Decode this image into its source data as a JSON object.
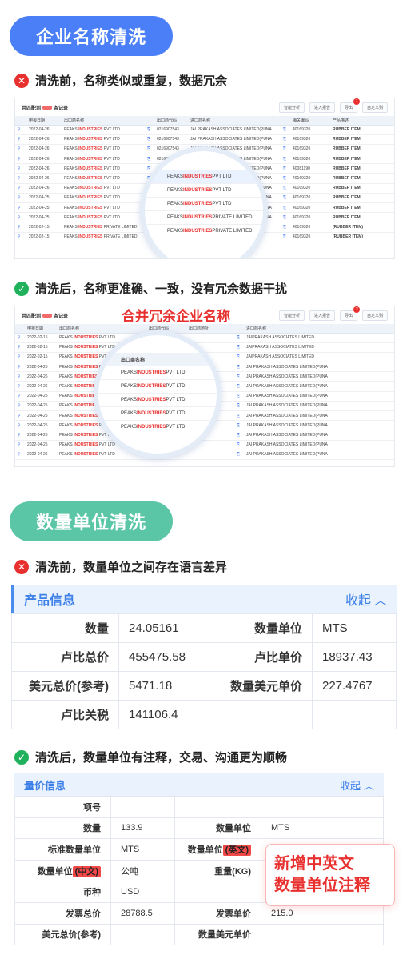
{
  "section1": {
    "title": "企业名称清洗",
    "before_caption": "清洗前，名称类似或重复，数据冗余",
    "after_caption": "清洗后，名称更准确、一致，没有冗余数据干扰",
    "before_shot": {
      "header_title": "共匹配到",
      "header_suffix": "条记录",
      "tools": [
        "智能分析",
        "进入报告",
        "导出",
        "自定义列"
      ],
      "badge": "1",
      "columns": [
        "申报日期",
        "出口商名称",
        "出口商代码",
        "进口商名称",
        "海关编码",
        "产品描述"
      ],
      "rows": [
        [
          "2022-04-26",
          "PEAKS ",
          "INDUSTRIES",
          " PVT LTD",
          "0216907543",
          "JAI PRAKASH ASSOCIATES LIMITED(PUNA",
          "40169320",
          "RUBBER ITEM"
        ],
        [
          "2022-04-26",
          "PEAKS ",
          "INDUSTRIES",
          " PVT LTD",
          "0216907543",
          "JAI PRAKASH ASSOCIATES LIMITED(PUNA",
          "40169320",
          "RUBBER ITEM"
        ],
        [
          "2022-04-26",
          "PEAKS ",
          "INDUSTRIES",
          " PVT LTD",
          "0216907543",
          "JAI PRAKASH ASSOCIATES LIMITED(PUNA",
          "40169320",
          "RUBBER ITEM"
        ],
        [
          "2022-04-26",
          "PEAKS ",
          "INDUSTRIES",
          " PVT LTD",
          "0216907543",
          "JAI PRAKASH ASSOCIATES LIMITED(PUNA",
          "40169320",
          "RUBBER ITEM"
        ],
        [
          "2022-04-26",
          "PEAKS ",
          "INDUSTRIES",
          " PVT LTD",
          "0216907543",
          "JAI PRAKASH ASSOCIATES LIMITED(PUNA",
          "40081190",
          "RUBBER ITEM"
        ],
        [
          "2022-04-26",
          "PEAKS ",
          "INDUSTRIES",
          " PVT LTD",
          "0216907543",
          "JAI PRAKASH ASSOCIATES LIMITED(PUNA",
          "40169320",
          "RUBBER ITEM"
        ],
        [
          "2022-04-26",
          "PEAKS ",
          "INDUSTRIES",
          " PVT LTD",
          "0216907543",
          "JAI PRAKASH ASSOCIATES LIMITED(PUNA",
          "40169320",
          "RUBBER ITEM"
        ],
        [
          "2022-04-25",
          "PEAKS ",
          "INDUSTRIES",
          " PVT LTD",
          "0216907543",
          "JAI PRAKASH ASSOCIATES LIMITED(PUNA",
          "40169320",
          "RUBBER ITEM"
        ],
        [
          "2022-04-25",
          "PEAKS ",
          "INDUSTRIES",
          " PVT LTD",
          "0216907543",
          "JAI PRAKASH ASSOCIATES LIMITED(PUNA",
          "40169320",
          "RUBBER ITEM"
        ],
        [
          "2022-04-25",
          "PEAKS ",
          "INDUSTRIES",
          " PVT LTD",
          "0216907543",
          "JAI PRAKASH ASSOCIATES LIMITED(PUNA",
          "40169320",
          "RUBBER ITEM"
        ],
        [
          "2022-02-15",
          "PEAKS ",
          "INDUSTRIES",
          " PRIVATE LIMITED",
          "0216907543",
          "JAI PRAKASH ASSOCIATES LIMITED",
          "40169320",
          "(RUBBER ITEM)"
        ],
        [
          "2022-02-15",
          "PEAKS ",
          "INDUSTRIES",
          " PRIVATE LIMITED",
          "0216907543",
          "JAI PRAKASH ASSOCIATES LIMITED",
          "40169320",
          "(RUBBER ITEM)"
        ]
      ],
      "lens_rows": [
        [
          "PEAKS ",
          "INDUSTRIES",
          " PVT LTD"
        ],
        [
          "PEAKS ",
          "INDUSTRIES",
          " PVT LTD"
        ],
        [
          "PEAKS ",
          "INDUSTRIES",
          " PVT LTD"
        ],
        [
          "PEAKS ",
          "INDUSTRIES",
          " PRIVATE LIMITED"
        ],
        [
          "PEAKS ",
          "INDUSTRIES",
          " PRIVATE LIMITED"
        ]
      ]
    },
    "after_shot": {
      "header_title": "共匹配到",
      "header_suffix": "条记录",
      "merge_label": "合并冗余企业名称",
      "tools": [
        "智能分析",
        "进入报告",
        "导出",
        "自定义列"
      ],
      "badge": "3",
      "columns": [
        "申报日期",
        "出口商名称",
        "出口商代码",
        "出口商地址",
        "进口商名称"
      ],
      "rows": [
        [
          "2022-02-15",
          "PEAKS ",
          "INDUSTRIES",
          " PVT LTD",
          "0216907543",
          "",
          "JAIPRAKASH ASSOCIATES LIMITED"
        ],
        [
          "2022-02-15",
          "PEAKS ",
          "INDUSTRIES",
          " PVT LTD",
          "0216907543",
          "",
          "JAIPRAKASH ASSOCIATES LIMITED"
        ],
        [
          "2022-02-15",
          "PEAKS ",
          "INDUSTRIES",
          " PVT LTD",
          "0216907543",
          "",
          "JAIPRAKASH ASSOCIATES LIMITED"
        ],
        [
          "2022-04-25",
          "PEAKS ",
          "INDUSTRIES",
          " PVT LTD",
          "0216907543",
          "",
          "JAI PRAKASH ASSOCIATES LIMITED(PUNA"
        ],
        [
          "2022-04-26",
          "PEAKS ",
          "INDUSTRIES",
          " PVT LTD",
          "0216907543",
          "",
          "JAI PRAKASH ASSOCIATES LIMITED(PUNA"
        ],
        [
          "2022-04-26",
          "PEAKS ",
          "INDUSTRIES",
          " PVT LTD",
          "0216907543",
          "",
          "JAI PRAKASH ASSOCIATES LIMITED(PUNA"
        ],
        [
          "2022-04-25",
          "PEAKS ",
          "INDUSTRIES",
          " PVT LTD",
          "0216907543",
          "",
          "JAI PRAKASH ASSOCIATES LIMITED(PUNA"
        ],
        [
          "2022-04-25",
          "PEAKS ",
          "INDUSTRIES",
          " PVT LTD",
          "0216907543",
          "",
          "JAI PRAKASH ASSOCIATES LIMITED(PUNA"
        ],
        [
          "2022-04-25",
          "PEAKS ",
          "INDUSTRIES",
          " PVT LTD",
          "0216907543",
          "",
          "JAI PRAKASH ASSOCIATES LIMITED(PUNA"
        ],
        [
          "2022-04-25",
          "PEAKS ",
          "INDUSTRIES",
          " PVT LTD",
          "0216907543",
          "",
          "JAI PRAKASH ASSOCIATES LIMITED(PUNA"
        ],
        [
          "2022-04-25",
          "PEAKS ",
          "INDUSTRIES",
          " PVT LTD",
          "0216907543",
          "",
          "JAI PRAKASH ASSOCIATES LIMITED(PUNA"
        ],
        [
          "2022-04-25",
          "PEAKS ",
          "INDUSTRIES",
          " PVT LTD",
          "0216907543",
          "",
          "JAI PRAKASH ASSOCIATES LIMITED(PUNA"
        ],
        [
          "2022-04-26",
          "PEAKS ",
          "INDUSTRIES",
          " PVT LTD",
          "0216907543",
          "",
          "JAI PRAKASH ASSOCIATES LIMITED(PUNA"
        ]
      ],
      "lens_header": "出口商名称",
      "lens_rows": [
        [
          "PEAKS ",
          "INDUSTRIES",
          " PVT LTD"
        ],
        [
          "PEAKS ",
          "INDUSTRIES",
          " PVT LTD"
        ],
        [
          "PEAKS ",
          "INDUSTRIES",
          " PVT LTD"
        ],
        [
          "PEAKS ",
          "INDUSTRIES",
          " PVT LTD"
        ],
        [
          "PEAKS ",
          "INDUSTRIES",
          " PVT LTD"
        ]
      ]
    }
  },
  "section2": {
    "title": "数量单位清洗",
    "before_caption": "清洗前，数量单位之间存在语言差异",
    "after_caption": "清洗后，数量单位有注释，交易、沟通更为顺畅",
    "panel1": {
      "title": "产品信息",
      "collapse": "收起",
      "rows": [
        [
          "数量",
          "24.05161",
          "数量单位",
          "MTS"
        ],
        [
          "卢比总价",
          "455475.58",
          "卢比单价",
          "18937.43"
        ],
        [
          "美元总价(参考)",
          "5471.18",
          "数量美元单价",
          "227.4767"
        ],
        [
          "卢比关税",
          "141106.4",
          "",
          ""
        ]
      ]
    },
    "panel2": {
      "title": "量价信息",
      "collapse": "收起",
      "rows": [
        [
          "项号",
          "",
          "",
          ""
        ],
        [
          "数量",
          "133.9",
          "数量单位",
          "MTS"
        ],
        [
          "标准数量单位",
          "MTS",
          "数量单位(英文)",
          ""
        ],
        [
          "数量单位(中文)",
          "公吨",
          "重量(KG)",
          ""
        ],
        [
          "币种",
          "USD",
          "",
          ""
        ],
        [
          "发票总价",
          "28788.5",
          "发票单价",
          "215.0"
        ],
        [
          "美元总价(参考)",
          "",
          "数量美元单价",
          ""
        ]
      ],
      "unit_en_prefix": "数量单位",
      "unit_en_tag": "(英文)",
      "unit_cn_prefix": "数量单位",
      "unit_cn_tag": "(中文)"
    },
    "note": [
      "新增中英文",
      "数量单位注释"
    ]
  }
}
